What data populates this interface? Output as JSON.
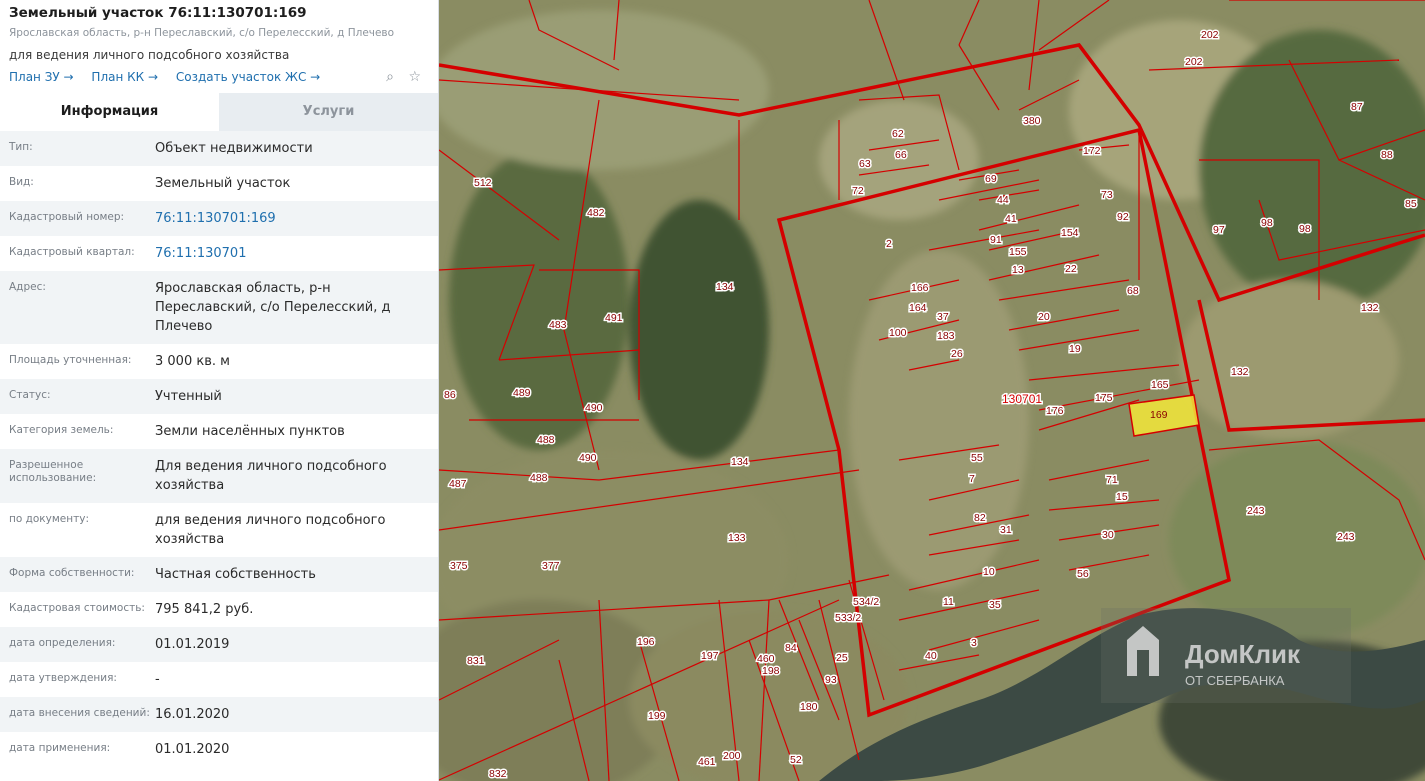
{
  "header": {
    "title": "Земельный участок 76:11:130701:169",
    "address": "Ярославская область, р-н Переславский, с/о Перелесский, д Плечево",
    "purpose": "для ведения личного подсобного хозяйства",
    "links": [
      "План ЗУ →",
      "План КК →",
      "Создать участок ЖС →"
    ]
  },
  "tabs": {
    "info": "Информация",
    "services": "Услуги"
  },
  "fields": [
    {
      "label": "Тип:",
      "value": "Объект недвижимости"
    },
    {
      "label": "Вид:",
      "value": "Земельный участок"
    },
    {
      "label": "Кадастровый номер:",
      "value": "76:11:130701:169"
    },
    {
      "label": "Кадастровый квартал:",
      "value": "76:11:130701"
    },
    {
      "label": "Адрес:",
      "value": "Ярославская область, р-н Переславский, с/о Перелесский, д Плечево"
    },
    {
      "label": "Площадь уточненная:",
      "value": "3 000 кв. м"
    },
    {
      "label": "Статус:",
      "value": "Учтенный"
    },
    {
      "label": "Категория земель:",
      "value": "Земли населённых пунктов"
    },
    {
      "label": "Разрешенное использование:",
      "value": "Для ведения личного подсобного хозяйства"
    },
    {
      "label": "по документу:",
      "value": "для ведения личного подсобного хозяйства"
    },
    {
      "label": "Форма собственности:",
      "value": "Частная собственность"
    },
    {
      "label": "Кадастровая стоимость:",
      "value": "795 841,2 руб."
    },
    {
      "label": "дата определения:",
      "value": "01.01.2019"
    },
    {
      "label": "дата утверждения:",
      "value": "-"
    },
    {
      "label": "дата внесения сведений:",
      "value": "16.01.2020"
    },
    {
      "label": "дата применения:",
      "value": "01.01.2020"
    }
  ],
  "map": {
    "quarter_label": "130701",
    "highlight_label": "169",
    "watermark_title": "ДомКлик",
    "watermark_sub": "ОТ СБЕРБАНКА",
    "parcel_labels": [
      "202",
      "202",
      "87",
      "88",
      "85",
      "380",
      "62",
      "63",
      "66",
      "72",
      "172",
      "69",
      "44",
      "41",
      "91",
      "155",
      "154",
      "73",
      "92",
      "97",
      "98",
      "98",
      "512",
      "482",
      "2",
      "13",
      "22",
      "68",
      "166",
      "164",
      "37",
      "100",
      "183",
      "26",
      "134",
      "20",
      "19",
      "483",
      "491",
      "132",
      "86",
      "489",
      "490",
      "488",
      "130701",
      "165",
      "176",
      "175",
      "132",
      "55",
      "7",
      "71",
      "15",
      "490",
      "487",
      "488",
      "134",
      "82",
      "31",
      "30",
      "243",
      "243",
      "133",
      "10",
      "56",
      "375",
      "377",
      "11",
      "35",
      "534/2",
      "533/2",
      "196",
      "197",
      "460",
      "84",
      "25",
      "198",
      "93",
      "40",
      "3",
      "831",
      "199",
      "180",
      "200",
      "461",
      "52",
      "832"
    ],
    "colors": {
      "boundary": "#d40000",
      "highlight_fill": "#f3e73a",
      "label_bg": "#ffffff"
    }
  }
}
